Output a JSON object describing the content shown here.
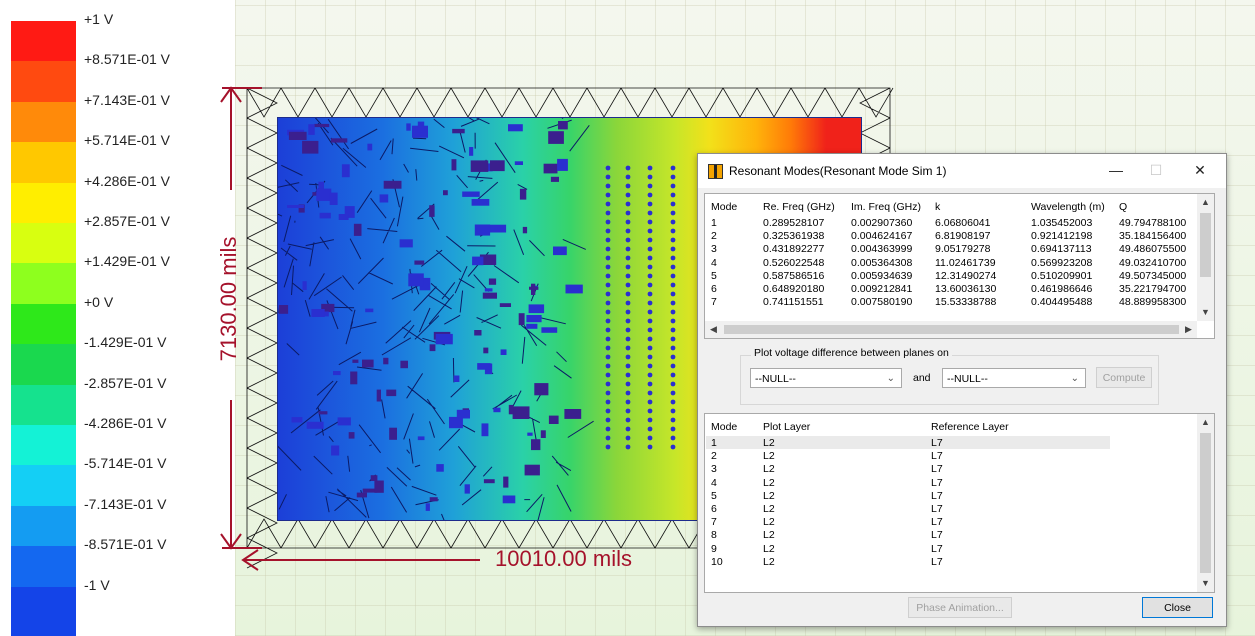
{
  "legend": {
    "entries": [
      {
        "label": "+1 V",
        "color": "#ff1a14"
      },
      {
        "label": "+8.571E-01 V",
        "color": "#ff4a10"
      },
      {
        "label": "+7.143E-01 V",
        "color": "#ff8a0a"
      },
      {
        "label": "+5.714E-01 V",
        "color": "#ffc800"
      },
      {
        "label": "+4.286E-01 V",
        "color": "#ffee00"
      },
      {
        "label": "+2.857E-01 V",
        "color": "#d8ff10"
      },
      {
        "label": "+1.429E-01 V",
        "color": "#8eff1e"
      },
      {
        "label": "+0 V",
        "color": "#2ee81a"
      },
      {
        "label": "-1.429E-01 V",
        "color": "#1ad84e"
      },
      {
        "label": "-2.857E-01 V",
        "color": "#15e28e"
      },
      {
        "label": "-4.286E-01 V",
        "color": "#14f2d6"
      },
      {
        "label": "-5.714E-01 V",
        "color": "#14cff5"
      },
      {
        "label": "-7.143E-01 V",
        "color": "#149cf2"
      },
      {
        "label": "-8.571E-01 V",
        "color": "#1468f0"
      },
      {
        "label": "-1 V",
        "color": "#1444e8"
      }
    ]
  },
  "plot": {
    "height_dim": "7130.00 mils",
    "width_dim": "10010.00 mils",
    "dim_color": "#a5122b"
  },
  "dialog": {
    "title": "Resonant Modes(Resonant Mode Sim 1)",
    "min_glyph": "—",
    "max_glyph": "☐",
    "close_glyph": "✕",
    "modes_table": {
      "headers": [
        "Mode",
        "Re. Freq (GHz)",
        "Im. Freq (GHz)",
        "k",
        "Wavelength (m)",
        "Q"
      ],
      "rows": [
        [
          "1",
          "0.289528107",
          "0.002907360",
          "6.06806041",
          "1.035452003",
          "49.794788100"
        ],
        [
          "2",
          "0.325361938",
          "0.004624167",
          "6.81908197",
          "0.921412198",
          "35.184156400"
        ],
        [
          "3",
          "0.431892277",
          "0.004363999",
          "9.05179278",
          "0.694137113",
          "49.486075500"
        ],
        [
          "4",
          "0.526022548",
          "0.005364308",
          "11.02461739",
          "0.569923208",
          "49.032410700"
        ],
        [
          "5",
          "0.587586516",
          "0.005934639",
          "12.31490274",
          "0.510209901",
          "49.507345000"
        ],
        [
          "6",
          "0.648920180",
          "0.009212841",
          "13.60036130",
          "0.461986646",
          "35.221794700"
        ],
        [
          "7",
          "0.741151551",
          "0.007580190",
          "15.53338788",
          "0.404495488",
          "48.889958300"
        ]
      ]
    },
    "plot_group": {
      "title": "Plot voltage difference between planes on",
      "combo1": "--NULL--",
      "and_label": "and",
      "combo2": "--NULL--",
      "compute_label": "Compute"
    },
    "layers_table": {
      "headers": [
        "Mode",
        "Plot Layer",
        "Reference Layer"
      ],
      "rows": [
        [
          "1",
          "L2",
          "L7"
        ],
        [
          "2",
          "L2",
          "L7"
        ],
        [
          "3",
          "L2",
          "L7"
        ],
        [
          "4",
          "L2",
          "L7"
        ],
        [
          "5",
          "L2",
          "L7"
        ],
        [
          "6",
          "L2",
          "L7"
        ],
        [
          "7",
          "L2",
          "L7"
        ],
        [
          "8",
          "L2",
          "L7"
        ],
        [
          "9",
          "L2",
          "L7"
        ],
        [
          "10",
          "L2",
          "L7"
        ]
      ]
    },
    "phase_animation_label": "Phase Animation...",
    "close_label": "Close"
  }
}
